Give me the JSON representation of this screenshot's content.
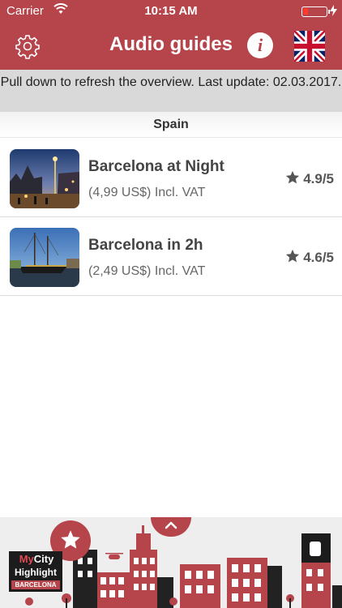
{
  "status_bar": {
    "carrier": "Carrier",
    "time": "10:15 AM"
  },
  "nav": {
    "title": "Audio guides",
    "info_glyph": "i",
    "settings_icon": "gear-icon",
    "language_icon": "uk-flag-icon"
  },
  "notice": {
    "text": "Pull down to refresh the overview. Last update: 02.03.2017."
  },
  "section": {
    "title": "Spain"
  },
  "guides": [
    {
      "name": "Barcelona at Night",
      "price": "(4,99 US$) Incl. VAT",
      "rating": "4.9/5"
    },
    {
      "name": "Barcelona in 2h",
      "price": "(2,49 US$) Incl. VAT",
      "rating": "4.6/5"
    }
  ],
  "banner": {
    "logo_line1_a": "My",
    "logo_line1_b": "City",
    "logo_line2": "Highlight",
    "logo_city": "BARCELONA"
  },
  "colors": {
    "brand": "#b6444b",
    "notice_bg": "#d9d9d9"
  }
}
